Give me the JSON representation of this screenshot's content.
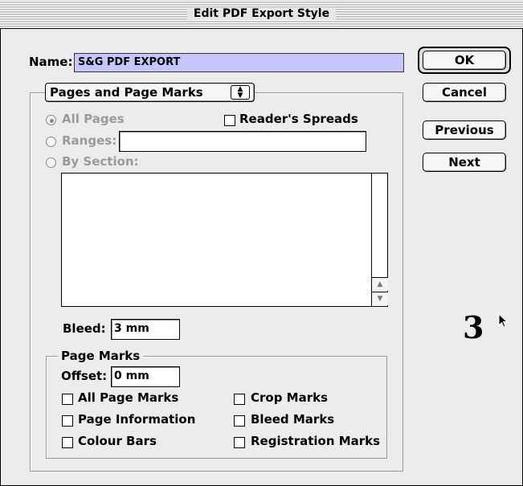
{
  "window": {
    "title": "Edit PDF Export Style"
  },
  "name": {
    "label": "Name:",
    "value": "S&G PDF EXPORT"
  },
  "buttons": {
    "ok": "OK",
    "cancel": "Cancel",
    "previous": "Previous",
    "next": "Next"
  },
  "popup": {
    "selected": "Pages and Page Marks"
  },
  "pages": {
    "all_pages": "All Pages",
    "readers_spreads": "Reader's Spreads",
    "ranges": "Ranges:",
    "ranges_value": "",
    "by_section": "By Section:",
    "bleed_label": "Bleed:",
    "bleed_value": "3 mm"
  },
  "page_marks": {
    "legend": "Page Marks",
    "offset_label": "Offset:",
    "offset_value": "0 mm",
    "all_page_marks": "All Page Marks",
    "page_information": "Page Information",
    "colour_bars": "Colour Bars",
    "crop_marks": "Crop Marks",
    "bleed_marks": "Bleed Marks",
    "registration_marks": "Registration Marks"
  },
  "annotation": {
    "number": "3"
  },
  "icons": {
    "popup": "updown-arrows-icon",
    "cursor": "arrow-cursor-icon"
  }
}
